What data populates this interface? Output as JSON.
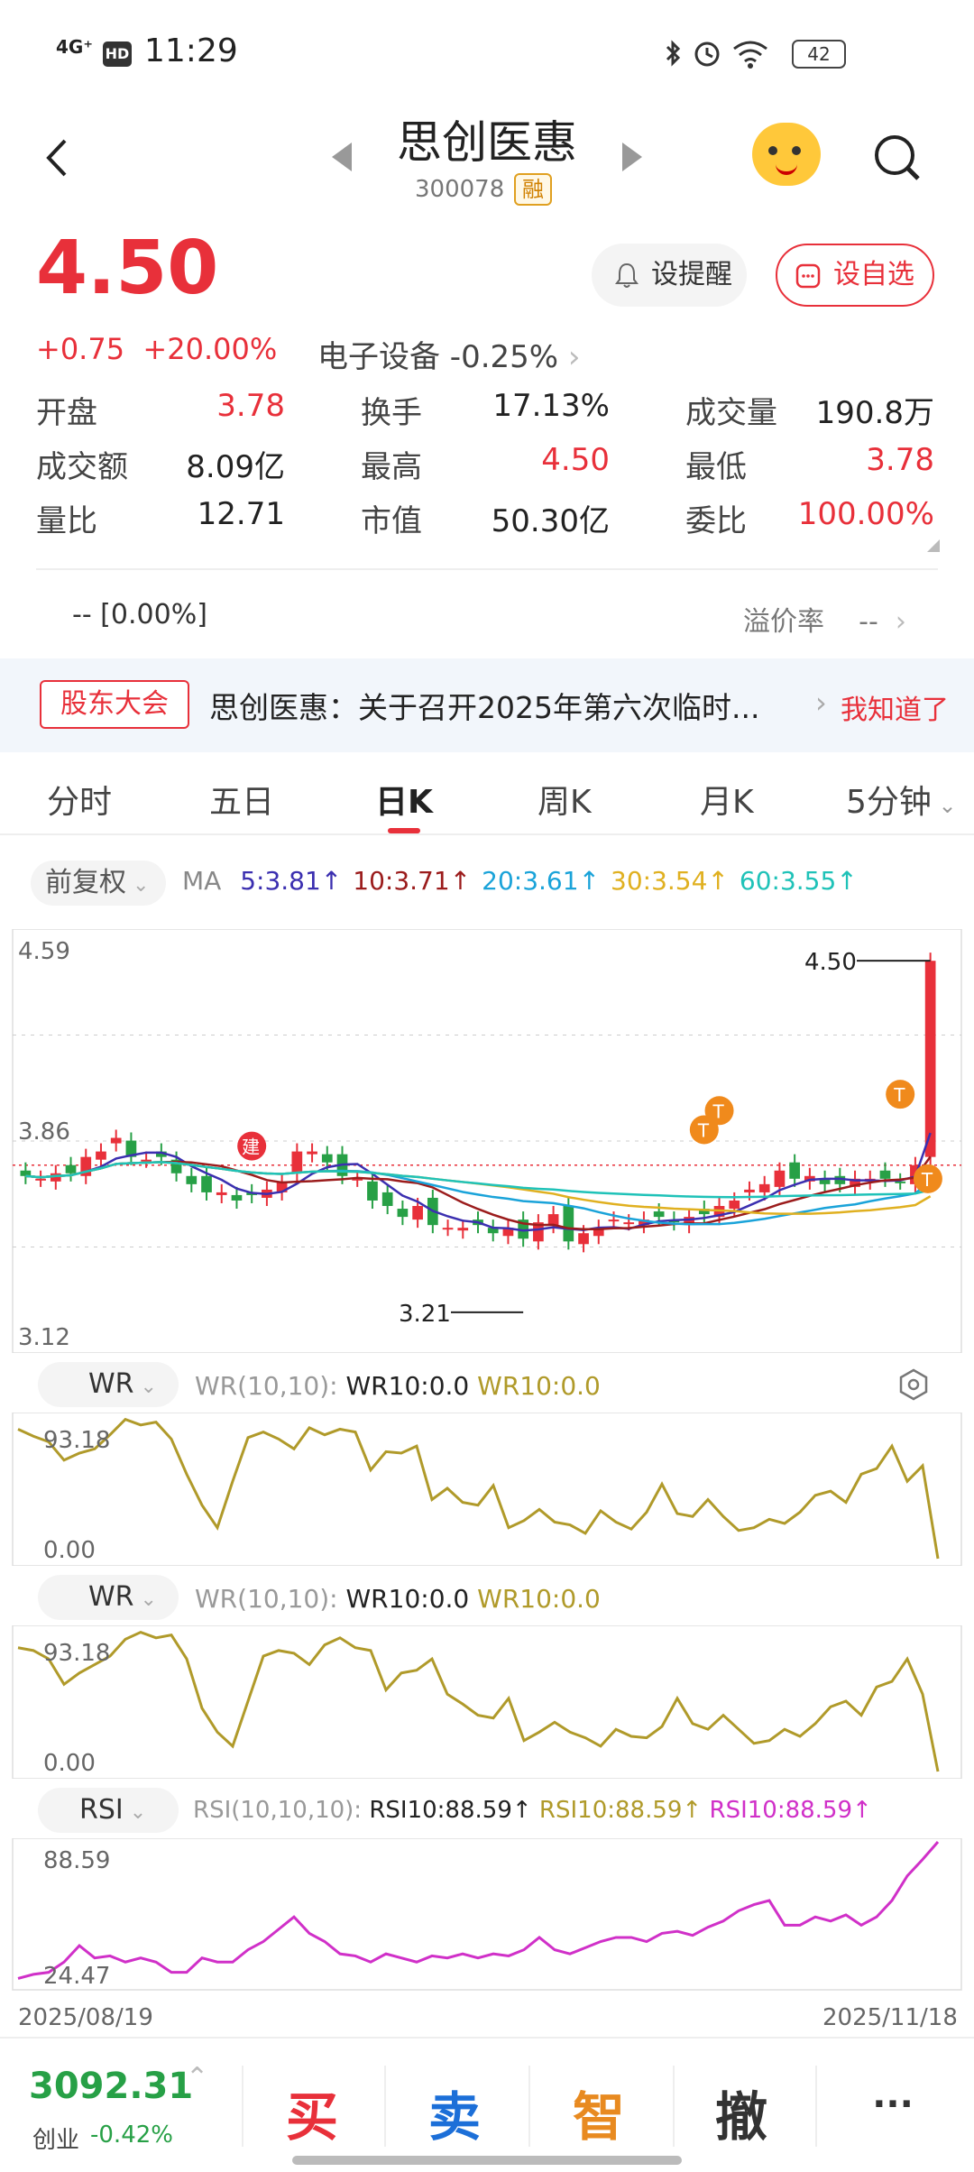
{
  "status": {
    "time": "11:29",
    "signal": "4G⁺",
    "hd": "HD",
    "battery": "42"
  },
  "header": {
    "title": "思创医惠",
    "code": "300078",
    "badge": "融"
  },
  "price": {
    "last": "4.50",
    "change": "+0.75",
    "change_pct": "+20.00%",
    "sector": "电子设备 -0.25%"
  },
  "buttons": {
    "alert": "设提醒",
    "favorite": "设自选"
  },
  "stats": [
    {
      "label": "开盘",
      "value": "3.78",
      "color": "#e8303a"
    },
    {
      "label": "换手",
      "value": "17.13%",
      "color": "#222222"
    },
    {
      "label": "成交量",
      "value": "190.8万",
      "color": "#222222"
    },
    {
      "label": "成交额",
      "value": "8.09亿",
      "color": "#222222"
    },
    {
      "label": "最高",
      "value": "4.50",
      "color": "#e8303a"
    },
    {
      "label": "最低",
      "value": "3.78",
      "color": "#e8303a"
    },
    {
      "label": "量比",
      "value": "12.71",
      "color": "#222222"
    },
    {
      "label": "市值",
      "value": "50.30亿",
      "color": "#222222"
    },
    {
      "label": "委比",
      "value": "100.00%",
      "color": "#e8303a"
    }
  ],
  "premium": {
    "left": "--  [0.00%]",
    "label": "溢价率",
    "value": "--"
  },
  "notice": {
    "tag": "股东大会",
    "text": "思创医惠：关于召开2025年第六次临时...",
    "action": "我知道了"
  },
  "tabs": [
    "分时",
    "五日",
    "日K",
    "周K",
    "月K",
    "5分钟"
  ],
  "active_tab": 2,
  "adjust": "前复权",
  "ma": {
    "label": "MA",
    "items": [
      {
        "text": "5:3.81↑",
        "color": "#3b2fb0"
      },
      {
        "text": "10:3.71↑",
        "color": "#9b1c1c"
      },
      {
        "text": "20:3.61↑",
        "color": "#1aa3d9"
      },
      {
        "text": "30:3.54↑",
        "color": "#e0b020"
      },
      {
        "text": "60:3.55↑",
        "color": "#1fc2b8"
      }
    ]
  },
  "kline": {
    "high_label": "4.59",
    "low_label": "3.12",
    "mid_label": "3.86",
    "max_marker": "4.50",
    "min_marker": "3.21",
    "build_marker": "建",
    "t_marker": "T"
  },
  "wr1": {
    "name": "WR",
    "params": "WR(10,10):",
    "v1": "WR10:0.0",
    "v2": "WR10:0.0",
    "top": "93.18",
    "bottom": "0.00"
  },
  "wr2": {
    "name": "WR",
    "params": "WR(10,10):",
    "v1": "WR10:0.0",
    "v2": "WR10:0.0",
    "top": "93.18",
    "bottom": "0.00"
  },
  "rsi": {
    "name": "RSI",
    "params": "RSI(10,10,10):",
    "v1": "RSI10:88.59↑",
    "v2": "RSI10:88.59↑",
    "v3": "RSI10:88.59↑",
    "top": "88.59",
    "bottom": "24.47"
  },
  "dates": {
    "start": "2025/08/19",
    "end": "2025/11/18"
  },
  "bottom": {
    "index_value": "3092.31",
    "index_name": "创业",
    "index_change": "-0.42%",
    "buy": "买",
    "sell": "卖",
    "smart": "智",
    "cancel": "撤",
    "more": "···"
  },
  "chart_data": {
    "type": "candlestick",
    "ylim": [
      3.12,
      4.59
    ],
    "closes": [
      3.71,
      3.7,
      3.72,
      3.72,
      3.78,
      3.8,
      3.85,
      3.78,
      3.77,
      3.78,
      3.72,
      3.68,
      3.65,
      3.65,
      3.62,
      3.64,
      3.66,
      3.69,
      3.8,
      3.8,
      3.76,
      3.71,
      3.7,
      3.62,
      3.6,
      3.56,
      3.6,
      3.53,
      3.52,
      3.52,
      3.53,
      3.5,
      3.52,
      3.48,
      3.54,
      3.57,
      3.47,
      3.5,
      3.52,
      3.55,
      3.54,
      3.55,
      3.56,
      3.54,
      3.56,
      3.57,
      3.6,
      3.62,
      3.66,
      3.68,
      3.73,
      3.7,
      3.71,
      3.68,
      3.68,
      3.7,
      3.7,
      3.7,
      3.69,
      3.75,
      4.5
    ],
    "wr": [
      92,
      87,
      83,
      70,
      75,
      78,
      88,
      99,
      95,
      97,
      85,
      60,
      38,
      22,
      55,
      86,
      90,
      85,
      78,
      93,
      88,
      92,
      90,
      63,
      76,
      75,
      80,
      42,
      50,
      40,
      38,
      52,
      22,
      27,
      35,
      26,
      24,
      18,
      34,
      26,
      21,
      33,
      53,
      32,
      30,
      42,
      30,
      20,
      22,
      28,
      25,
      33,
      45,
      48,
      40,
      60,
      64,
      80,
      55,
      66,
      0
    ],
    "wr2": [
      88,
      86,
      80,
      62,
      70,
      76,
      82,
      94,
      99,
      95,
      97,
      80,
      45,
      28,
      18,
      50,
      82,
      86,
      84,
      76,
      90,
      95,
      88,
      86,
      58,
      70,
      72,
      80,
      55,
      48,
      40,
      38,
      52,
      22,
      28,
      35,
      28,
      24,
      18,
      30,
      25,
      24,
      32,
      52,
      34,
      30,
      40,
      30,
      20,
      22,
      30,
      25,
      34,
      46,
      50,
      40,
      60,
      64,
      80,
      55,
      0
    ],
    "rsi": [
      22,
      24,
      25,
      30,
      38,
      32,
      33,
      30,
      32,
      30,
      25,
      25,
      32,
      30,
      30,
      36,
      40,
      46,
      52,
      44,
      40,
      34,
      33,
      30,
      34,
      32,
      30,
      33,
      32,
      34,
      32,
      34,
      33,
      36,
      42,
      36,
      34,
      37,
      40,
      42,
      42,
      40,
      44,
      45,
      43,
      47,
      50,
      55,
      58,
      60,
      48,
      48,
      52,
      50,
      53,
      48,
      52,
      60,
      72,
      80,
      88.59
    ]
  }
}
